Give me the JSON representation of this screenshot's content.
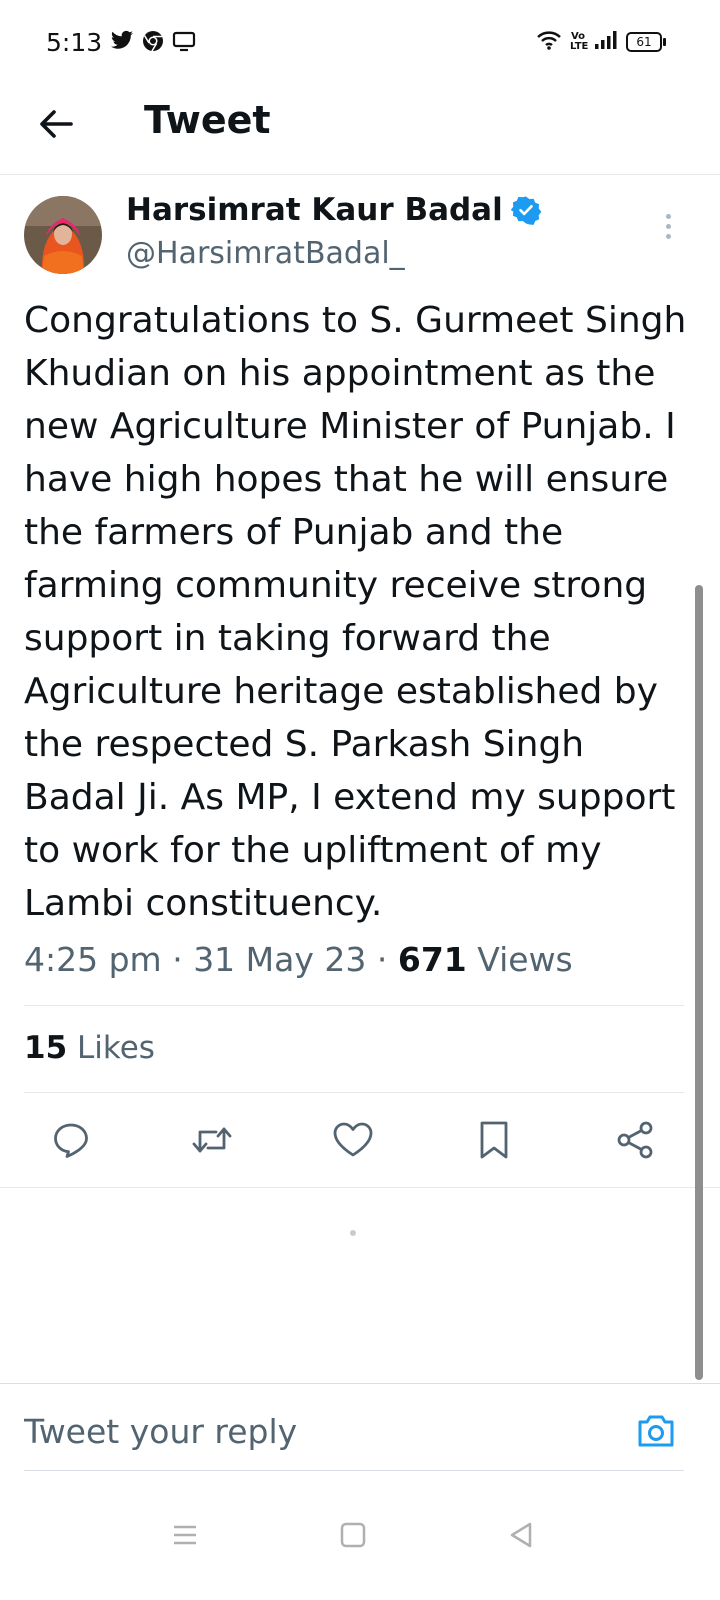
{
  "status_bar": {
    "time": "5:13",
    "battery": "61"
  },
  "header": {
    "title": "Tweet"
  },
  "tweet": {
    "author_name": "Harsimrat Kaur Badal",
    "handle": "@HarsimratBadal_",
    "verified": true,
    "text": "Congratulations to S. Gurmeet Singh Khudian on his appointment as the new Agriculture Minister of Punjab. I have high hopes that he will ensure the farmers of Punjab and the farming community receive strong support in taking forward the Agriculture heritage established by the respected S. Parkash Singh Badal Ji. As MP, I extend my support to work for the upliftment of my Lambi constituency.",
    "time": "4:25 pm",
    "date": "31 May 23",
    "views_count": "671",
    "views_label": "Views",
    "likes_count": "15",
    "likes_label": "Likes"
  },
  "reply": {
    "placeholder": "Tweet your reply"
  },
  "colors": {
    "accent": "#1d9bf0",
    "text_primary": "#0f1419",
    "text_secondary": "#536471",
    "divider": "#e6e9ec"
  },
  "icons": {
    "back": "arrow-left-icon",
    "verified": "verified-badge-icon",
    "more": "more-vertical-icon",
    "reply": "reply-icon",
    "retweet": "retweet-icon",
    "like": "heart-icon",
    "bookmark": "bookmark-icon",
    "share": "share-icon",
    "camera": "camera-icon"
  }
}
